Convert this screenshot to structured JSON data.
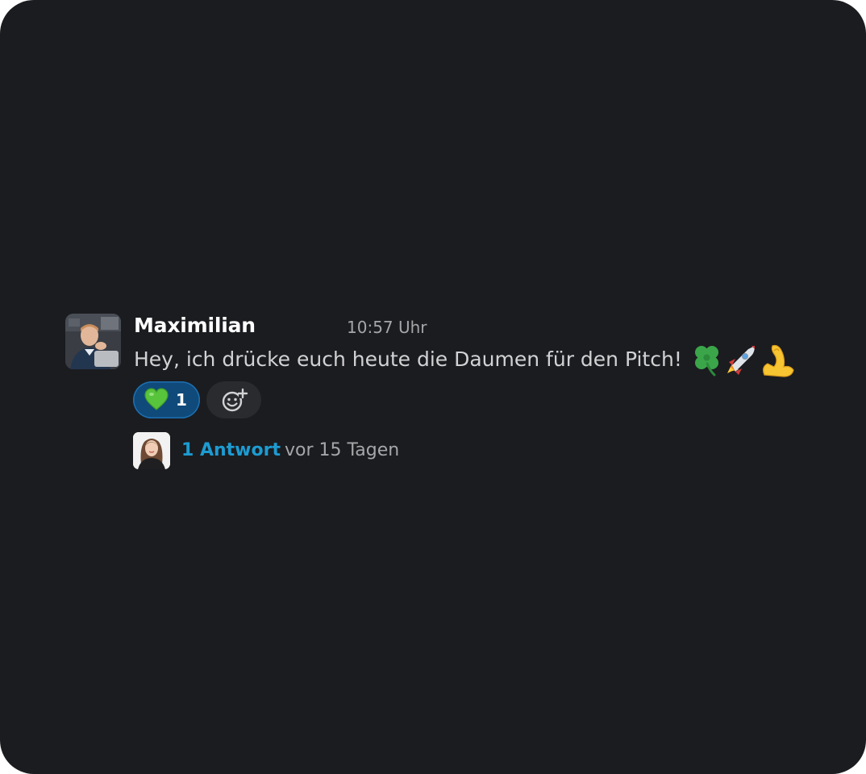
{
  "message": {
    "author": "Maximilian",
    "timestamp": "10:57 Uhr",
    "text": "Hey, ich drücke euch heute die Daumen für den Pitch!",
    "inline_emojis": [
      "four-leaf-clover",
      "rocket",
      "flexed-biceps"
    ],
    "reactions": [
      {
        "emoji": "green-heart",
        "count": "1",
        "active": true
      }
    ],
    "add_reaction_icon": "add-reaction-icon",
    "thread": {
      "reply_count": "1 Antwort",
      "last_reply": "vor 15 Tagen"
    }
  },
  "colors": {
    "background": "#1b1c20",
    "text": "#d1d2d3",
    "muted": "#a5a6a8",
    "link": "#1d9bd1",
    "reaction_active_bg": "#0f4a7a",
    "reaction_active_border": "#1d6fb0"
  }
}
